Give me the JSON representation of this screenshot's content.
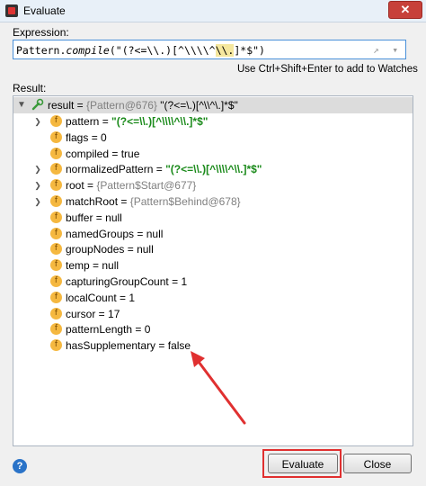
{
  "window": {
    "title": "Evaluate",
    "close_glyph": "✕"
  },
  "expression": {
    "label": "Expression:",
    "parts": {
      "p1": "Pattern.",
      "fn": "compile",
      "p2": "(\"(?<=\\\\.)[^\\\\\\\\^",
      "hl": "\\\\.",
      "p3": "]*$\")"
    },
    "icons": [
      "expand-icon",
      "history-icon"
    ],
    "icon_glyphs": "↗ ▾"
  },
  "hint": "Use Ctrl+Shift+Enter to add to Watches",
  "result": {
    "label": "Result:",
    "root": {
      "name": "result",
      "eq": " = ",
      "ref": "{Pattern@676}",
      "value": " \"(?<=\\.)[^\\\\^\\.]*$\""
    },
    "fields": [
      {
        "expandable": true,
        "name": "pattern",
        "value": "\"(?<=\\\\.)[^\\\\\\\\^\\\\.]*$\"",
        "kind": "string"
      },
      {
        "expandable": false,
        "name": "flags",
        "value": "0",
        "kind": "plain"
      },
      {
        "expandable": false,
        "name": "compiled",
        "value": "true",
        "kind": "plain"
      },
      {
        "expandable": true,
        "name": "normalizedPattern",
        "value": "\"(?<=\\\\.)[^\\\\\\\\^\\\\.]*$\"",
        "kind": "string"
      },
      {
        "expandable": true,
        "name": "root",
        "value": "{Pattern$Start@677}",
        "kind": "ref"
      },
      {
        "expandable": true,
        "name": "matchRoot",
        "value": "{Pattern$Behind@678}",
        "kind": "ref"
      },
      {
        "expandable": false,
        "name": "buffer",
        "value": "null",
        "kind": "plain"
      },
      {
        "expandable": false,
        "name": "namedGroups",
        "value": "null",
        "kind": "plain"
      },
      {
        "expandable": false,
        "name": "groupNodes",
        "value": "null",
        "kind": "plain"
      },
      {
        "expandable": false,
        "name": "temp",
        "value": "null",
        "kind": "plain"
      },
      {
        "expandable": false,
        "name": "capturingGroupCount",
        "value": "1",
        "kind": "plain"
      },
      {
        "expandable": false,
        "name": "localCount",
        "value": "1",
        "kind": "plain"
      },
      {
        "expandable": false,
        "name": "cursor",
        "value": "17",
        "kind": "plain"
      },
      {
        "expandable": false,
        "name": "patternLength",
        "value": "0",
        "kind": "plain"
      },
      {
        "expandable": false,
        "name": "hasSupplementary",
        "value": "false",
        "kind": "plain"
      }
    ],
    "field_icon_letter": "f",
    "equals": " = "
  },
  "buttons": {
    "evaluate": "Evaluate",
    "close": "Close",
    "help": "?"
  },
  "colors": {
    "annotation": "#e03030",
    "string_value": "#1a8a1a",
    "ref_value": "#808080"
  }
}
